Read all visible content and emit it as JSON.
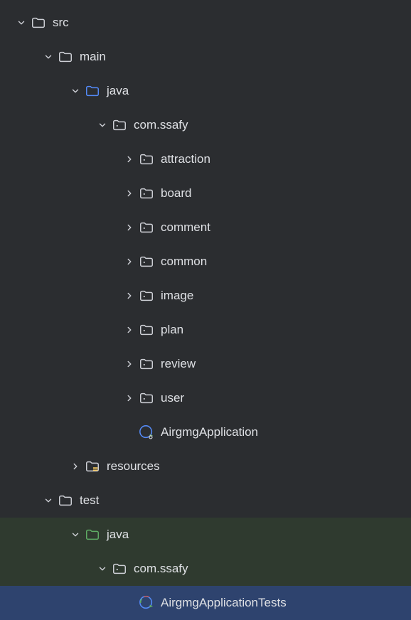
{
  "tree": {
    "src": {
      "label": "src"
    },
    "main": {
      "label": "main"
    },
    "java_main": {
      "label": "java"
    },
    "com_ssafy_main": {
      "label": "com.ssafy"
    },
    "attraction": {
      "label": "attraction"
    },
    "board": {
      "label": "board"
    },
    "comment": {
      "label": "comment"
    },
    "common": {
      "label": "common"
    },
    "image": {
      "label": "image"
    },
    "plan": {
      "label": "plan"
    },
    "review": {
      "label": "review"
    },
    "user": {
      "label": "user"
    },
    "airgmg_app": {
      "label": "AirgmgApplication"
    },
    "resources": {
      "label": "resources"
    },
    "test": {
      "label": "test"
    },
    "java_test": {
      "label": "java"
    },
    "com_ssafy_test": {
      "label": "com.ssafy"
    },
    "airgmg_app_tests": {
      "label": "AirgmgApplicationTests"
    }
  },
  "colors": {
    "folder_default": "#ced0d6",
    "folder_source": "#548af7",
    "folder_test": "#5fad65",
    "folder_resource": "#ced0d6",
    "package": "#ced0d6",
    "class": "#548af7",
    "class_test": "#5fad65",
    "chevron": "#ced0d6"
  }
}
